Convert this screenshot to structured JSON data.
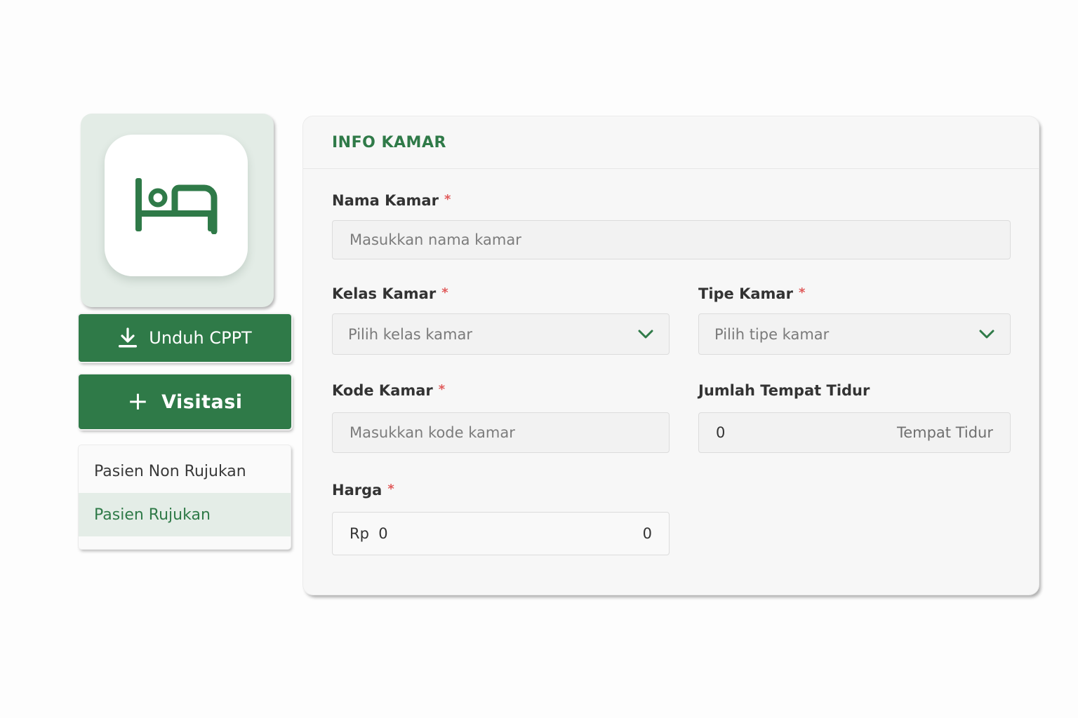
{
  "sidebar": {
    "bed_icon": "bed-icon",
    "download_button": {
      "label": "Unduh CPPT",
      "icon": "download-icon"
    },
    "visit_button": {
      "label": "Visitasi",
      "icon_glyph": "+"
    },
    "menu": [
      {
        "label": "Pasien Non Rujukan",
        "active": false
      },
      {
        "label": "Pasien Rujukan",
        "active": true
      }
    ]
  },
  "card": {
    "title": "INFO KAMAR",
    "required_mark": "*",
    "nama_kamar": {
      "label": "Nama Kamar",
      "placeholder": "Masukkan nama kamar"
    },
    "kelas_kamar": {
      "label": "Kelas Kamar",
      "placeholder": "Pilih kelas kamar"
    },
    "tipe_kamar": {
      "label": "Tipe Kamar",
      "placeholder": "Pilih tipe kamar"
    },
    "kode_kamar": {
      "label": "Kode Kamar",
      "placeholder": "Masukkan kode kamar"
    },
    "jumlah_tempat_tidur": {
      "label": "Jumlah Tempat Tidur",
      "value": "0",
      "suffix": "Tempat Tidur"
    },
    "harga": {
      "label": "Harga",
      "prefix": "Rp",
      "value": "0",
      "right_value": "0"
    }
  },
  "colors": {
    "brand_green": "#2f7a48",
    "required_red": "#e05a5a",
    "active_bg": "#e4ede7"
  }
}
